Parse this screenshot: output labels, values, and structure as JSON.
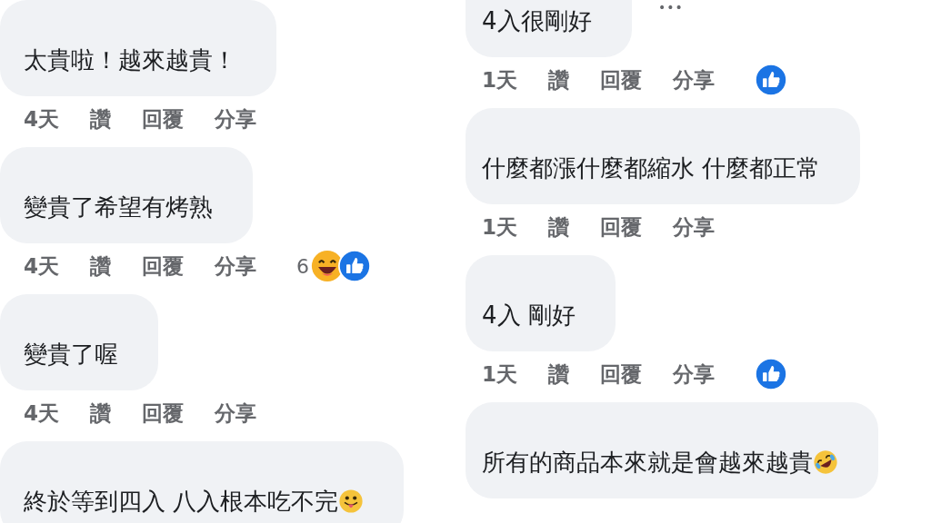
{
  "columns": [
    {
      "cut_top": false,
      "comments": [
        {
          "text": "太貴啦！越來越貴！",
          "actions": {
            "time": "4天",
            "like": "讚",
            "reply": "回覆",
            "share": "分享"
          }
        },
        {
          "text": "變貴了希望有烤熟",
          "actions": {
            "time": "4天",
            "like": "讚",
            "reply": "回覆",
            "share": "分享"
          },
          "reactions": {
            "count": "6",
            "icons": [
              {
                "kind": "haha"
              },
              {
                "kind": "like"
              }
            ]
          }
        },
        {
          "text": "變貴了喔",
          "actions": {
            "time": "4天",
            "like": "讚",
            "reply": "回覆",
            "share": "分享"
          }
        },
        {
          "text": "終於等到四入 八入根本吃不完",
          "emoji": {
            "kind": "tongue"
          }
        }
      ]
    },
    {
      "cut_top": true,
      "more": "•••",
      "comments": [
        {
          "text": "4入很剛好",
          "actions": {
            "time": "1天",
            "like": "讚",
            "reply": "回覆",
            "share": "分享"
          },
          "reactions": {
            "icons": [
              {
                "kind": "like"
              }
            ]
          }
        },
        {
          "text": "什麼都漲什麼都縮水 什麼都正常",
          "actions": {
            "time": "1天",
            "like": "讚",
            "reply": "回覆",
            "share": "分享"
          }
        },
        {
          "text": "4入 剛好",
          "actions": {
            "time": "1天",
            "like": "讚",
            "reply": "回覆",
            "share": "分享"
          },
          "reactions": {
            "icons": [
              {
                "kind": "like"
              }
            ]
          }
        },
        {
          "text": "所有的商品本來就是會越來越貴",
          "emoji": {
            "kind": "rofl"
          }
        }
      ]
    }
  ]
}
